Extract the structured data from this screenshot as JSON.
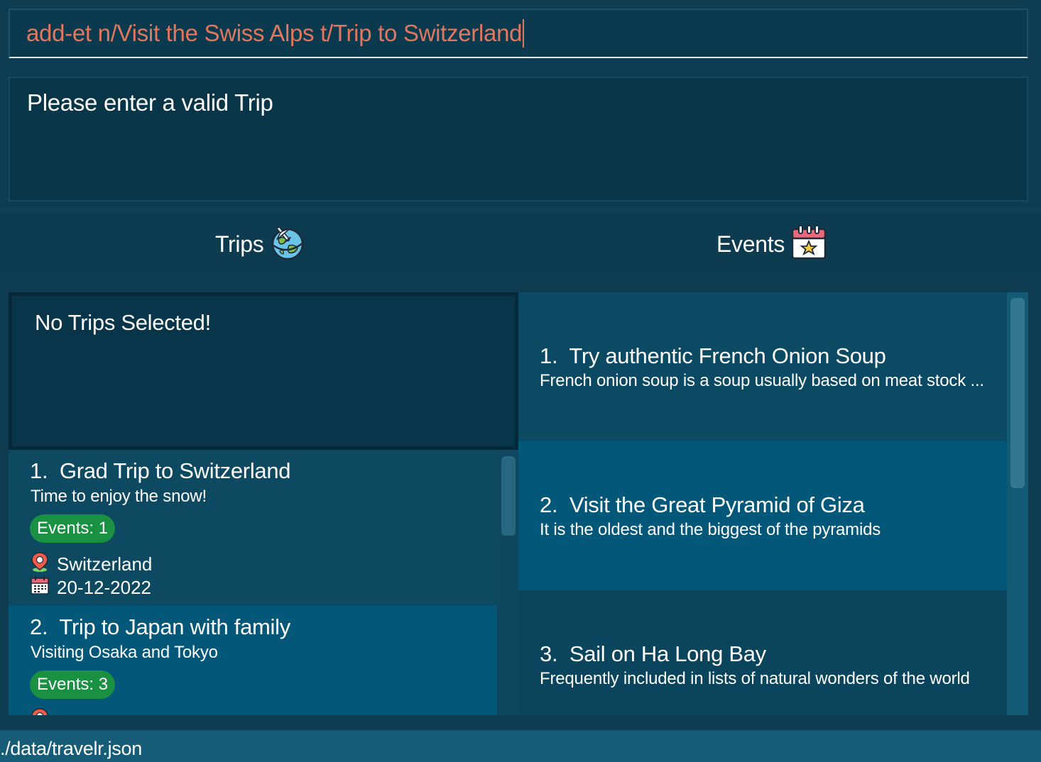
{
  "colors": {
    "background": "#0e3d52",
    "command_text": "#e0775e",
    "badge": "#1a9043",
    "selected_card": "#03587a"
  },
  "command": {
    "value": "add-et n/Visit the Swiss Alps t/Trip to Switzerland"
  },
  "result": {
    "message": "Please enter a valid Trip"
  },
  "tabs": {
    "trips_label": "Trips",
    "trips_icon": "globe-airplane-icon",
    "events_label": "Events",
    "events_icon": "calendar-star-icon"
  },
  "trip_detail": {
    "placeholder": "No Trips Selected!"
  },
  "trips": [
    {
      "index": "1.",
      "title": "Grad Trip to Switzerland",
      "description": "Time to enjoy the snow!",
      "events_badge": "Events: 1",
      "location": "Switzerland",
      "location_icon": "location-pin-icon",
      "date": "20-12-2022",
      "date_icon": "calendar-icon"
    },
    {
      "index": "2.",
      "title": "Trip to Japan with family",
      "description": "Visiting Osaka and Tokyo",
      "events_badge": "Events: 3",
      "location_icon": "location-pin-icon"
    }
  ],
  "events": [
    {
      "index": "1.",
      "title": "Try authentic French Onion Soup",
      "description": "French onion soup is a soup usually based on meat stock ..."
    },
    {
      "index": "2.",
      "title": "Visit the Great Pyramid of Giza",
      "description": "It is the oldest and the biggest of the pyramids"
    },
    {
      "index": "3.",
      "title": "Sail on Ha Long Bay",
      "description": "Frequently included in lists of natural wonders of the world"
    }
  ],
  "status_bar": {
    "file_path": "./data/travelr.json"
  }
}
